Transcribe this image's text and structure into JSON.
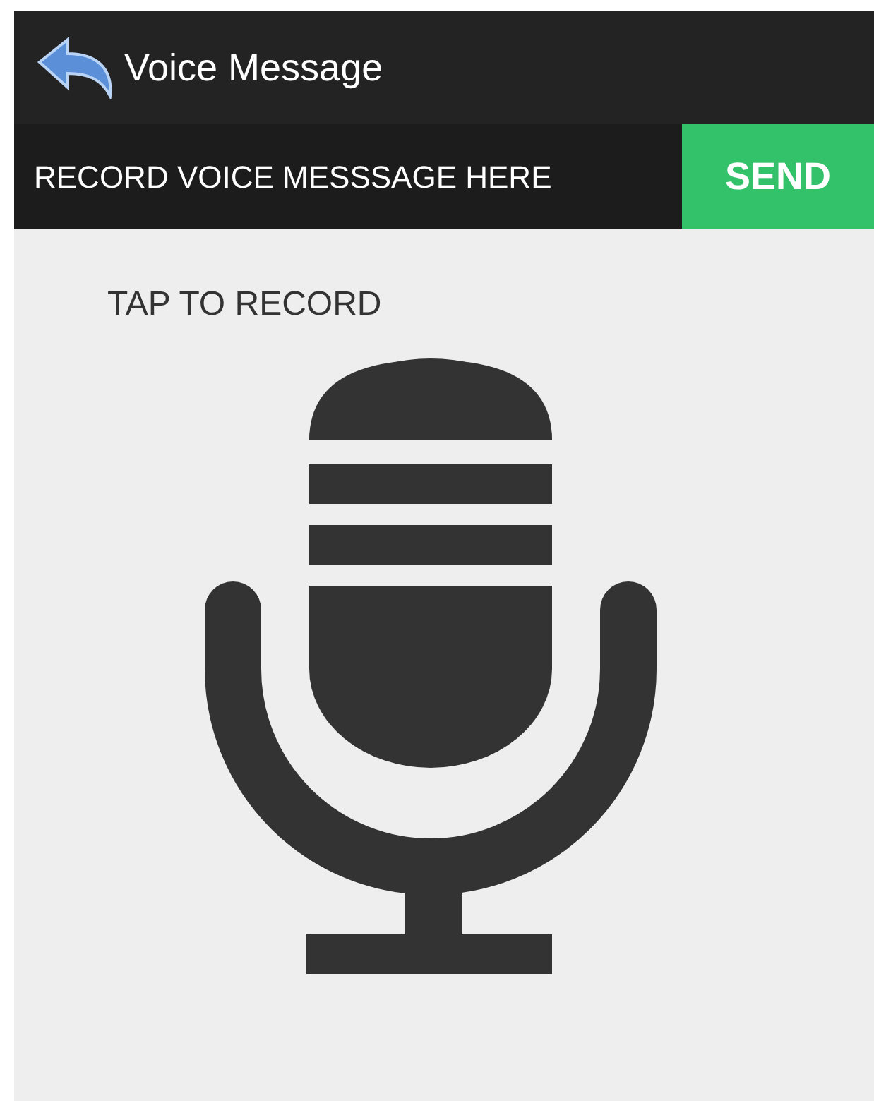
{
  "app_bar": {
    "title": "Voice Message"
  },
  "record_bar": {
    "label": "RECORD VOICE MESSSAGE HERE",
    "send_button": "SEND"
  },
  "body": {
    "hint": "TAP TO RECORD"
  }
}
